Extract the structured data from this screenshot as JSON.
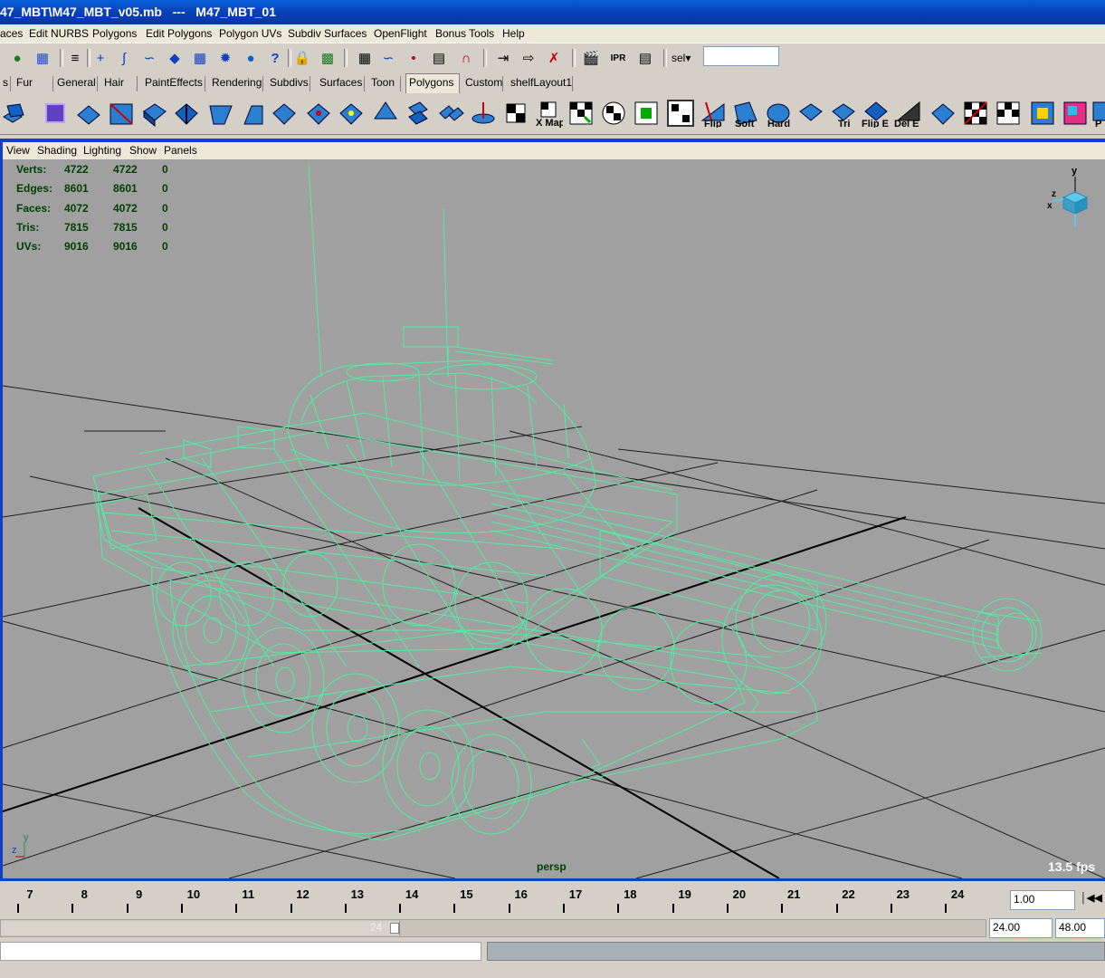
{
  "window": {
    "title": "47_MBT\\M47_MBT_v05.mb   ---   M47_MBT_01"
  },
  "menubar": {
    "items": [
      "aces",
      "Edit NURBS",
      "Polygons",
      "Edit Polygons",
      "Polygon UVs",
      "Subdiv Surfaces",
      "OpenFlight",
      "Bonus Tools",
      "Help"
    ]
  },
  "statusline": {
    "sel_label": "sel",
    "sel_value": ""
  },
  "shelf_tabs": [
    "s",
    "Fur",
    "General",
    "Hair",
    "PaintEffects",
    "Rendering",
    "Subdivs",
    "Surfaces",
    "Toon",
    "Polygons",
    "Custom",
    "shelfLayout1"
  ],
  "shelf_active": "Polygons",
  "shelf_labels": {
    "map": "X Map",
    "flip": "Flip",
    "soft": "Soft",
    "hard": "Hard",
    "tri": "Tri",
    "flipe": "Flip E",
    "dele": "Del E",
    "p": "P"
  },
  "viewport_menu": [
    "View",
    "Shading",
    "Lighting",
    "Show",
    "Panels"
  ],
  "hud": {
    "rows": [
      {
        "label": "Verts:",
        "a": "4722",
        "b": "4722",
        "c": "0"
      },
      {
        "label": "Edges:",
        "a": "8601",
        "b": "8601",
        "c": "0"
      },
      {
        "label": "Faces:",
        "a": "4072",
        "b": "4072",
        "c": "0"
      },
      {
        "label": "Tris:",
        "a": "7815",
        "b": "7815",
        "c": "0"
      },
      {
        "label": "UVs:",
        "a": "9016",
        "b": "9016",
        "c": "0"
      }
    ],
    "camera": "persp",
    "fps": "13.5 fps",
    "axis_top": {
      "y": "y",
      "z": "z",
      "x": "x"
    },
    "axis_corner": {
      "y": "y",
      "z": "z"
    }
  },
  "timeline": {
    "frames": [
      "7",
      "8",
      "9",
      "10",
      "11",
      "12",
      "13",
      "14",
      "15",
      "16",
      "17",
      "18",
      "19",
      "20",
      "21",
      "22",
      "23",
      "24"
    ],
    "current_time": "1.00",
    "range_end_label": "24",
    "range_end": "24.00",
    "anim_end": "48.00"
  },
  "colors": {
    "wireframe": "#4df0a0",
    "viewport_bg": "#a0a0a0",
    "title_bar": "#0a5fd8",
    "hud_text": "#004000"
  }
}
